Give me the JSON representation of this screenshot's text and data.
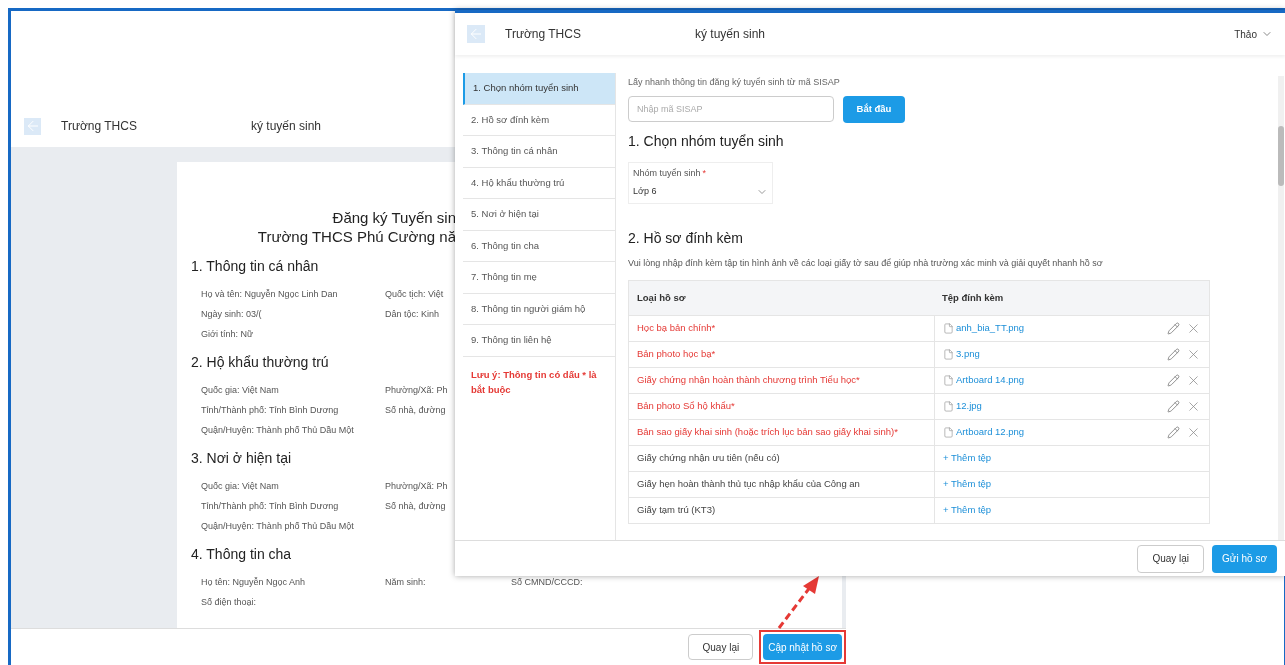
{
  "background_window": {
    "header": {
      "school": "Trường THCS",
      "title": "ký tuyến sinh"
    },
    "document": {
      "title_lines": [
        "Đăng ký Tuyến sin",
        "Trường THCS Phú Cường nă"
      ],
      "sections": [
        {
          "heading": "1. Thông tin cá nhân",
          "rows": [
            [
              "Họ và tên: Nguyễn Ngọc Linh Dan",
              "Quốc tịch: Việt"
            ],
            [
              "Ngày sinh: 03/(",
              "Dân tộc: Kinh"
            ],
            [
              "Giới tính: Nữ"
            ]
          ]
        },
        {
          "heading": "2. Hộ khẩu thường trú",
          "rows": [
            [
              "Quốc gia: Việt Nam",
              "Phường/Xã: Ph"
            ],
            [
              "Tỉnh/Thành phố: Tỉnh Bình Dương",
              "Số nhà, đường"
            ],
            [
              "Quận/Huyện: Thành phố Thủ Dầu Một"
            ]
          ]
        },
        {
          "heading": "3. Nơi ở hiện tại",
          "rows": [
            [
              "Quốc gia: Việt Nam",
              "Phường/Xã: Ph"
            ],
            [
              "Tỉnh/Thành phố: Tỉnh Bình Dương",
              "Số nhà, đường"
            ],
            [
              "Quận/Huyện: Thành phố Thủ Dầu Một"
            ]
          ]
        },
        {
          "heading": "4. Thông tin cha",
          "rows": [
            [
              "Họ tên: Nguyễn Ngọc Anh",
              "Năm sinh:",
              "Số CMND/CCCD:"
            ],
            [
              "Số điện thoại:"
            ]
          ]
        }
      ]
    },
    "footer": {
      "back_button": "Quay lại",
      "update_button": "Cập nhật hồ sơ",
      "update_highlighted": true
    }
  },
  "foreground_window": {
    "header": {
      "school": "Trường THCS",
      "title": "ký tuyến sinh",
      "user": "Thảo"
    },
    "sidebar": {
      "items": [
        {
          "label": "1. Chọn nhóm tuyển sinh",
          "selected": true
        },
        {
          "label": "2. Hồ sơ đính kèm",
          "selected": false
        },
        {
          "label": "3. Thông tin cá nhân",
          "selected": false
        },
        {
          "label": "4. Hộ khẩu thường trú",
          "selected": false
        },
        {
          "label": "5. Nơi ở hiện tại",
          "selected": false
        },
        {
          "label": "6. Thông tin cha",
          "selected": false
        },
        {
          "label": "7. Thông tin mẹ",
          "selected": false
        },
        {
          "label": "8. Thông tin người giám hộ",
          "selected": false
        },
        {
          "label": "9. Thông tin liên hệ",
          "selected": false
        }
      ],
      "note": "Lưu ý: Thông tin có dấu * là bắt buộc"
    },
    "quick_fill": {
      "label": "Lấy nhanh thông tin đăng ký tuyển sinh từ mã SISAP",
      "placeholder": "Nhập mã SISAP",
      "button": "Bắt đầu"
    },
    "section_1": {
      "heading": "1. Chọn nhóm tuyển sinh",
      "select": {
        "label": "Nhóm tuyển sinh",
        "required_mark": "*",
        "value": "Lớp 6"
      }
    },
    "section_2": {
      "heading": "2. Hồ sơ đính kèm",
      "description": "Vui lòng nhập đính kèm tập tin hình ảnh về các loại giấy tờ sau để giúp nhà trường xác minh và giải quyết nhanh hồ sơ",
      "table": {
        "columns": [
          "Loại hồ sơ",
          "Tệp đính kèm"
        ],
        "rows": [
          {
            "kind": "attached",
            "required": true,
            "name": "Học bạ bản chính*",
            "file": "anh_bia_TT.png"
          },
          {
            "kind": "attached",
            "required": true,
            "name": "Bản photo học bạ*",
            "file": "3.png"
          },
          {
            "kind": "attached",
            "required": true,
            "name": "Giấy chứng nhận hoàn thành chương trình Tiểu học*",
            "file": "Artboard 14.png"
          },
          {
            "kind": "attached",
            "required": true,
            "name": "Bản photo Sổ hộ khẩu*",
            "file": "12.jpg"
          },
          {
            "kind": "attached",
            "required": true,
            "name": "Bản sao giấy khai sinh (hoặc trích lục bản sao giấy khai sinh)*",
            "file": "Artboard 12.png"
          },
          {
            "kind": "empty",
            "required": false,
            "name": "Giấy chứng nhận ưu tiên (nếu có)",
            "file": "+ Thêm tệp"
          },
          {
            "kind": "empty",
            "required": false,
            "name": "Giấy hẹn hoàn thành thủ tục nhập khẩu của Công an",
            "file": "+ Thêm tệp"
          },
          {
            "kind": "empty",
            "required": false,
            "name": "Giấy tạm trú (KT3)",
            "file": "+ Thêm tệp"
          }
        ]
      }
    },
    "footer": {
      "back_button": "Quay lại",
      "submit_button": "Gửi hồ sơ"
    }
  }
}
